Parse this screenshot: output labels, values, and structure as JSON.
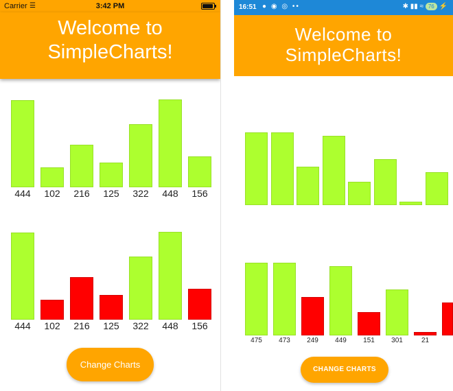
{
  "ios": {
    "status": {
      "carrier": "Carrier",
      "time": "3:42 PM"
    },
    "title": "Welcome to\nSimpleCharts!",
    "chart1": {
      "values": [
        444,
        102,
        216,
        125,
        322,
        448,
        156
      ],
      "labels": [
        "444",
        "102",
        "216",
        "125",
        "322",
        "448",
        "156"
      ],
      "colors": [
        "lime",
        "lime",
        "lime",
        "lime",
        "lime",
        "lime",
        "lime"
      ]
    },
    "chart2": {
      "values": [
        444,
        102,
        216,
        125,
        322,
        448,
        156
      ],
      "labels": [
        "444",
        "102",
        "216",
        "125",
        "322",
        "448",
        "156"
      ],
      "colors": [
        "lime",
        "red",
        "red",
        "red",
        "lime",
        "lime",
        "red"
      ]
    },
    "button_label": "Change Charts"
  },
  "android": {
    "status": {
      "time": "16:51",
      "battery": "76"
    },
    "title": "Welcome to\nSimpleCharts!",
    "chart1": {
      "values": [
        475,
        473,
        249,
        449,
        151,
        301,
        21,
        215
      ],
      "colors": [
        "lime",
        "lime",
        "lime",
        "lime",
        "lime",
        "lime",
        "lime",
        "lime"
      ]
    },
    "chart2": {
      "values": [
        475,
        473,
        249,
        449,
        151,
        301,
        21,
        215
      ],
      "labels": [
        "475",
        "473",
        "249",
        "449",
        "151",
        "301",
        "21"
      ],
      "colors": [
        "lime",
        "lime",
        "red",
        "lime",
        "red",
        "lime",
        "red",
        "red"
      ]
    },
    "button_label": "CHANGE CHARTS"
  },
  "colors": {
    "accent": "#ffa500",
    "bar_positive": "#adff2f",
    "bar_negative": "#ff0000",
    "android_statusbar": "#1e88d7"
  }
}
